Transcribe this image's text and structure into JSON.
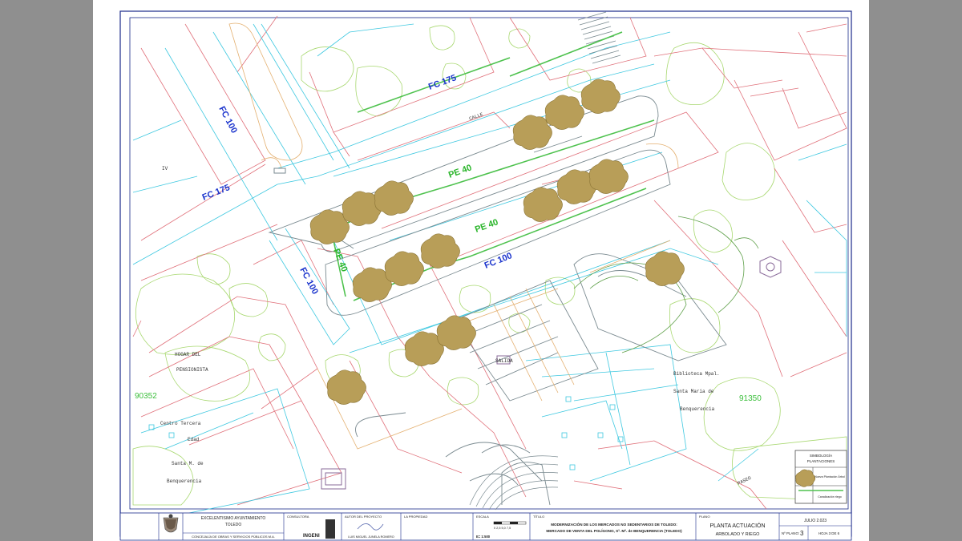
{
  "plan_labels": {
    "fc175_top": "FC 175",
    "fc175_left": "FC 175",
    "fc100_left_top": "FC 100",
    "fc100_left_bottom": "FC 100",
    "fc100_bottom": "FC 100",
    "pe40_upper": "PE 40",
    "pe40_lower": "PE 40",
    "pe40_vertical": "PE 40",
    "calle": "CALLE",
    "paseo": "PASEO",
    "iv": "IV",
    "sign_board": "SALIDA",
    "parcel_left": "90352",
    "parcel_right": "91350",
    "highrel_1": "HOGAR DEL",
    "highrel_2": "PENSIONISTA",
    "centro_1": "Centro Tercera",
    "centro_2": "Edad",
    "centro_3": "Santa M. de",
    "centro_4": "Benquerencia",
    "biblio_1": "Biblioteca Mpal.",
    "biblio_2": "Santa María de",
    "biblio_3": "Benquerencia"
  },
  "legend": {
    "title_1": "SIMBOLOGÍA",
    "title_2": "PLANTACIONES",
    "item_tree": "Nueva Plantación Árbol",
    "item_line": "Canalización riego"
  },
  "title_block": {
    "client_1": "EXCELENTISIMO AYUNTAMIENTO",
    "client_2": "TOLEDO",
    "client_3": "CONCEJALÍA DE OBRAS Y SERVICIOS PÚBLICOS M.A.",
    "consultora_label": "CONSULTORA",
    "consultora_name": "INGENI",
    "autor_label": "AUTOR DEL PROYECTO",
    "autor_name": "LUIS MIGUEL JUNELA ROMERO",
    "propiedad_label": "LA PROPIEDAD",
    "escala_label": "ESCALA",
    "escala_ticks": "0   2,5  5,0  7,5",
    "escala_value": "E= 1:500",
    "titulo_label": "TÍTULO",
    "titulo_1": "MODERNIZACIÓN DE LOS MERCADOS NO SEDENTARIOS DE TOLEDO:",
    "titulo_2": "MERCADO DE VENTA DEL POLÍGONO, Sª. Mª. de BENQUERENCIA (TOLEDO)",
    "plano_label": "PLANO",
    "plano_1": "PLANTA ACTUACIÓN",
    "plano_2": "ARBOLADO Y RIEGO",
    "fecha": "JULIO 2.023",
    "nplano_label": "Nº PLANO:",
    "nplano_value": "3",
    "hoja": "HOJA 3 DE 6"
  },
  "colors": {
    "border": "#1a2a8a",
    "red_lines": "#e0707a",
    "cyan_lines": "#3ec8e0",
    "green_lines": "#8fcf5a",
    "trees": "#b89e58",
    "label_blue": "#1a33cc",
    "label_green": "#2ab52a"
  }
}
